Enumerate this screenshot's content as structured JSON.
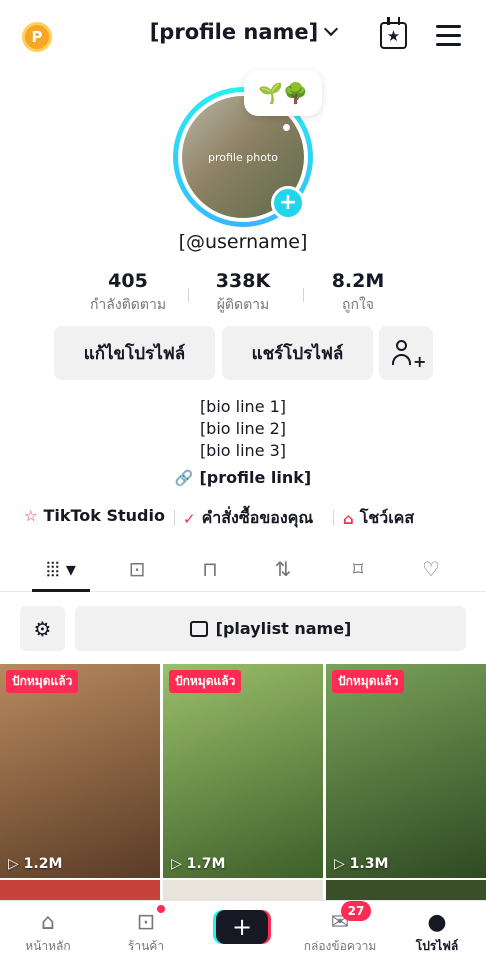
{
  "header": {
    "coin_label": "P",
    "title": "[profile name]",
    "calendar_icon": "calendar-star-icon",
    "menu_icon": "hamburger-icon"
  },
  "profile": {
    "bubble_icons": [
      "seedling-icon",
      "tree-icon"
    ],
    "avatar_alt": "profile photo",
    "handle": "[@username]",
    "stats": [
      {
        "value": "405",
        "label": "กำลังติดตาม"
      },
      {
        "value": "338K",
        "label": "ผู้ติดตาม"
      },
      {
        "value": "8.2M",
        "label": "ถูกใจ"
      }
    ],
    "buttons": {
      "edit": "แก้ไขโปรไฟล์",
      "share": "แชร์โปรไฟล์"
    },
    "bio_lines": [
      "[bio line 1]",
      "[bio line 2]",
      "[bio line 3]"
    ],
    "link": "[profile link]"
  },
  "quick_links": [
    {
      "label": "TikTok Studio",
      "icon": "person-star-icon"
    },
    {
      "label": "คำสั่งซื้อของคุณ",
      "icon": "bag-check-icon"
    },
    {
      "label": "โชว์เคส",
      "icon": "shop-bag-icon"
    }
  ],
  "tabs": [
    {
      "name": "videos",
      "icon": "grid-icon",
      "active": true
    },
    {
      "name": "shop",
      "icon": "bag-icon",
      "active": false
    },
    {
      "name": "private",
      "icon": "lock-icon",
      "active": false
    },
    {
      "name": "reposts",
      "icon": "repost-icon",
      "active": false
    },
    {
      "name": "favorites",
      "icon": "bookmark-icon",
      "active": false
    },
    {
      "name": "liked",
      "icon": "heart-hidden-icon",
      "active": false
    }
  ],
  "playlist": {
    "filter_icon": "settings-icon",
    "label": "[playlist name]"
  },
  "videos": [
    {
      "tag": "ปักหมุดแล้ว",
      "views": "1.2M",
      "color": "#8a5a3c"
    },
    {
      "tag": "ปักหมุดแล้ว",
      "views": "1.7M",
      "color": "#6b8f4a"
    },
    {
      "tag": "ปักหมุดแล้ว",
      "views": "1.3M",
      "color": "#4f7a3a"
    }
  ],
  "nav": {
    "home": "หน้าหลัก",
    "shop": "ร้านค้า",
    "inbox": "กล่องข้อความ",
    "inbox_badge": "27",
    "profile": "โปรไฟล์"
  },
  "colors": {
    "accent": "#fe2c55",
    "cyan": "#25f4ee"
  }
}
